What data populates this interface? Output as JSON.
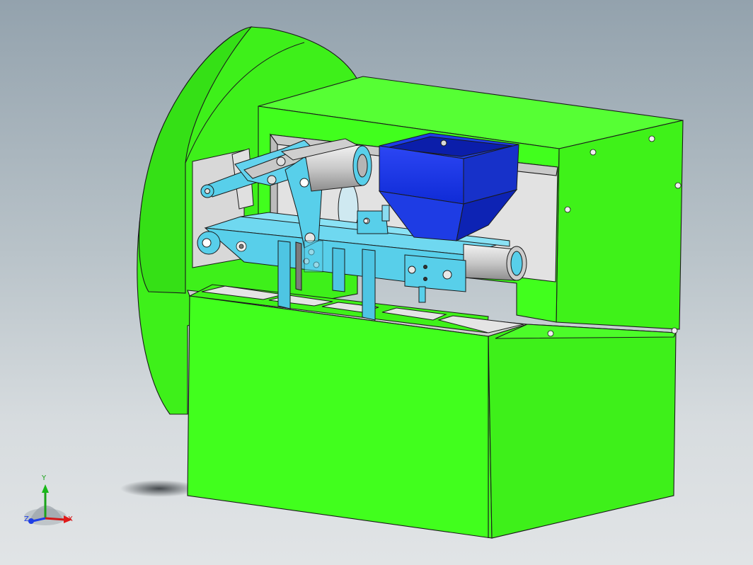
{
  "view": {
    "background_top": "#93a2ad",
    "background_bottom": "#e1e4e6"
  },
  "model": {
    "frame_color": "#41ff1d",
    "conveyor_color": "#58cfea",
    "hopper_color": "#1f3fe6",
    "roller_color": "#cfcfcf",
    "plate_color": "#e4e4e4"
  },
  "triad": {
    "x_label": "X",
    "y_label": "Y",
    "z_label": "Z"
  }
}
